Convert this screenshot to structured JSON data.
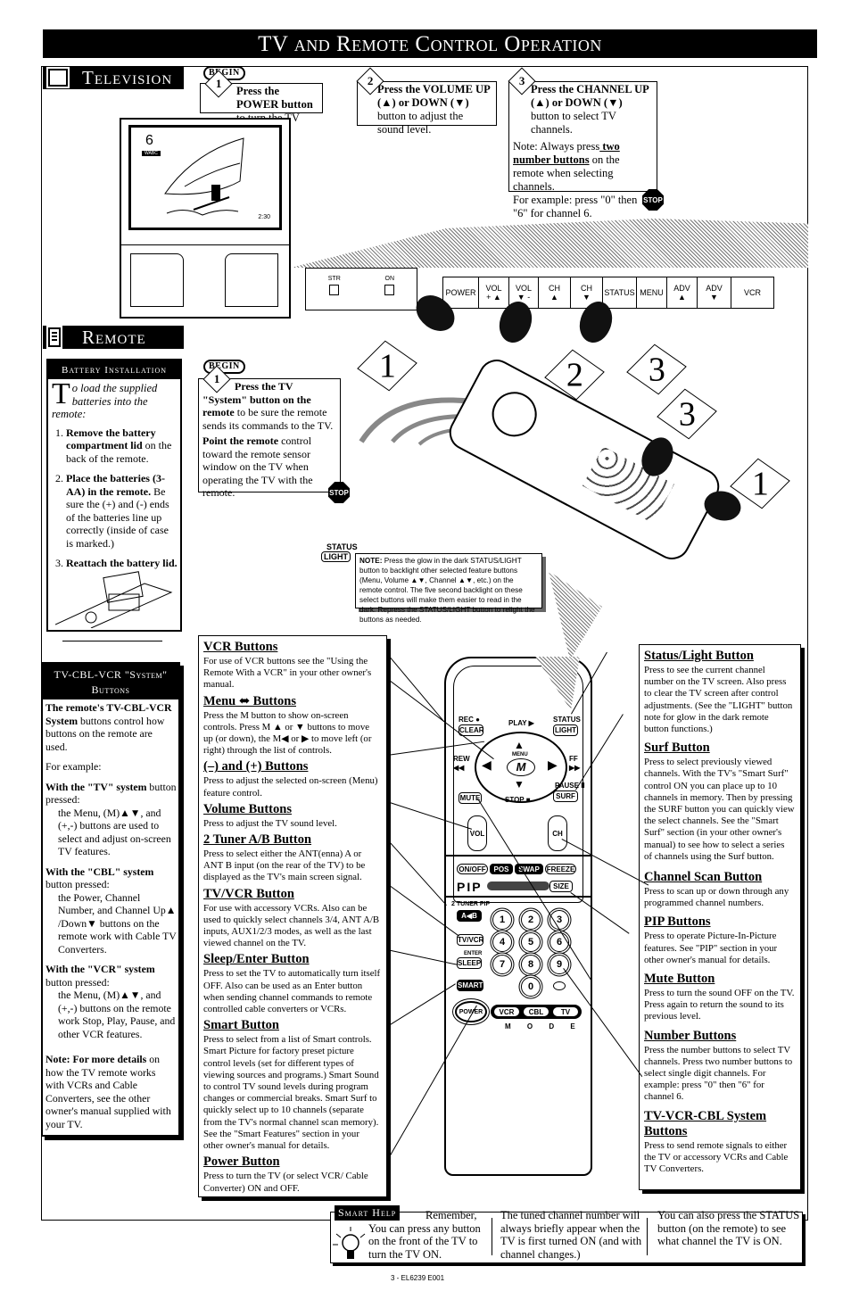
{
  "page_title": "TV and Remote Control Operation",
  "television": {
    "section_label": "Television",
    "begin_label": "BEGIN",
    "stop_label": "STOP",
    "steps": [
      {
        "number": "1",
        "bold": "Press the POWER button",
        "text": " to turn the TV ON."
      },
      {
        "number": "2",
        "bold": "Press the VOLUME UP (▲) or DOWN (▼)",
        "text": " button to adjust the sound level."
      },
      {
        "number": "3",
        "bold": "Press the CHANNEL UP (▲) or DOWN (▼)",
        "text": " button to select TV channels."
      }
    ],
    "step3_note": {
      "prefix": "Note: Always press",
      "underline": " two number buttons",
      "suffix": " on the remote when selecting channels.",
      "example": "For example: press \"0\" then \"6\" for channel 6."
    },
    "screen": {
      "channel": "6",
      "channel_tag": "WABC",
      "time": "2:30"
    },
    "front_panel": {
      "left_buttons": [
        "STR",
        "ON"
      ],
      "buttons": [
        {
          "top": "POWER",
          "bottom": ""
        },
        {
          "top": "VOL",
          "bottom": "+ ▲"
        },
        {
          "top": "VOL",
          "bottom": "▼ -"
        },
        {
          "top": "CH",
          "bottom": "▲"
        },
        {
          "top": "CH",
          "bottom": "▼"
        },
        {
          "top": "STATUS",
          "bottom": ""
        },
        {
          "top": "MENU",
          "bottom": ""
        },
        {
          "top": "ADV",
          "bottom": "▲"
        },
        {
          "top": "ADV",
          "bottom": "▼"
        },
        {
          "top": "VCR",
          "bottom": ""
        }
      ]
    },
    "hand_labels": [
      "1",
      "2",
      "3"
    ]
  },
  "remote": {
    "section_label": "Remote",
    "begin_label": "BEGIN",
    "stop_label": "STOP",
    "step1": {
      "number": "1",
      "bold": "Press the TV \"System\" button on the remote",
      "text": " to be sure the remote sends its commands to the TV.",
      "bold2": "Point the remote",
      "text2": " control toward the remote sensor window on the TV when operating the TV with the remote."
    },
    "hand_labels": [
      "3",
      "1"
    ],
    "battery": {
      "heading": "Battery Installation",
      "dropcap": "T",
      "intro": "o load the supplied batteries into the remote:",
      "steps": [
        {
          "bold": "Remove the battery compartment lid",
          "text": " on the back of the remote."
        },
        {
          "bold": "Place the batteries (3-AA) in the remote.",
          "text": " Be sure the (+) and (-) ends of the batteries line up correctly (inside of case is marked.)"
        },
        {
          "bold": "Reattach the battery lid.",
          "text": ""
        }
      ]
    },
    "light_note": {
      "status_label": "STATUS",
      "light_label": "LIGHT",
      "bold": "NOTE:",
      "text": " Press the glow in the dark STATUS/LIGHT button to backlight other selected feature buttons (Menu, Volume ▲▼, Channel ▲▼, etc.) on the remote control. The five second backlight on these select buttons will make them easier to read in the dark. Repress the STATUS/LIGHT button to relight the buttons as needed."
    }
  },
  "system_buttons": {
    "heading_line1": "TV-CBL-VCR \"System\"",
    "heading_line2": "Buttons",
    "intro_bold": "The remote's TV-CBL-VCR System",
    "intro_text": " buttons control how buttons on the remote are used.",
    "example": "For example:",
    "tv_bold": "With the \"TV\" system",
    "tv_text": " button pressed:",
    "tv_detail": "the Menu, (M)▲▼, and (+,-) buttons are used to select and adjust on-screen TV features.",
    "cbl_bold": "With the \"CBL\" system",
    "cbl_text": " button pressed:",
    "cbl_detail": "the Power, Channel Number, and Channel Up▲ /Down▼ buttons on the remote work with Cable TV Converters.",
    "vcr_bold": "With the \"VCR\" system",
    "vcr_text": " button pressed:",
    "vcr_detail": "the Menu, (M)▲▼, and (+,-) buttons on the remote work Stop, Play, Pause, and other VCR features.",
    "note_bold": "Note: For more details",
    "note_text": " on how the TV remote works with VCRs and Cable Converters, see the other owner's manual supplied with your TV."
  },
  "left_descriptions": [
    {
      "title": "VCR Buttons",
      "text": "For use of VCR buttons see the \"Using the Remote With a VCR\" in your other owner's manual."
    },
    {
      "title": "Menu ⬌ Buttons",
      "text": "Press the M button to show on-screen controls. Press M ▲ or ▼ buttons to move up (or down), the M◀ or ▶ to move left (or right) through the list of controls."
    },
    {
      "title": "(–) and (+) Buttons",
      "text": "Press to adjust the selected on-screen (Menu) feature control."
    },
    {
      "title": "Volume Buttons",
      "text": "Press to adjust the TV sound level."
    },
    {
      "title": "2 Tuner A/B Button",
      "text": "Press to select either the ANT(enna) A or ANT B input (on the rear of the TV) to be displayed as the TV's main screen signal."
    },
    {
      "title": "TV/VCR Button",
      "text": "For use with accessory VCRs. Also can be used to quickly select channels 3/4, ANT A/B inputs, AUX1/2/3 modes, as well as the last viewed channel on the TV."
    },
    {
      "title": "Sleep/Enter Button",
      "text": "Press to set the TV to automatically turn itself OFF. Also can be used as an Enter button when sending channel commands to remote controlled cable converters or VCRs."
    },
    {
      "title": "Smart Button",
      "text": "Press to select from a list of Smart controls. Smart Picture for factory preset picture control levels (set for different types of viewing sources and programs.) Smart Sound to control TV sound levels during program changes or commercial breaks. Smart Surf to quickly select up to 10 channels (separate from the TV's normal channel scan memory). See the \"Smart Features\" section in your other owner's manual for details."
    },
    {
      "title": "Power Button",
      "text": "Press to turn the TV (or select VCR/ Cable Converter) ON and OFF."
    }
  ],
  "right_descriptions": [
    {
      "title": "Status/Light Button",
      "text": "Press to see the current channel number on the TV screen. Also press to clear the TV screen after control adjustments. (See the \"LIGHT\" button note for glow in the dark remote button functions.)"
    },
    {
      "title": "Surf Button",
      "text": "Press to select previously viewed channels. With the TV's \"Smart Surf\" control ON you can place up to 10 channels in memory. Then by pressing the SURF button you can quickly view the select channels. See the \"Smart Surf\" section (in your other owner's manual) to see how to select a series of channels using the Surf button."
    },
    {
      "title": "Channel Scan Button",
      "text": "Press to scan up or down through any programmed channel numbers."
    },
    {
      "title": "PIP Buttons",
      "text": "Press to operate Picture-In-Picture features. See \"PIP\" section in your other owner's manual for details."
    },
    {
      "title": "Mute Button",
      "text": "Press to turn the sound OFF on the TV. Press again to return the sound to its previous level."
    },
    {
      "title": "Number Buttons",
      "text": "Press the number buttons to select TV channels. Press two number buttons to select single digit channels. For example: press \"0\" then \"6\" for channel 6."
    },
    {
      "title": "TV-VCR-CBL System Buttons",
      "text": "Press to send remote signals to either the TV or accessory VCRs and Cable TV Converters."
    }
  ],
  "remote_diagram": {
    "rec": "REC ●",
    "clear": "CLEAR",
    "play": "PLAY ▶",
    "status": "STATUS",
    "light": "LIGHT",
    "rew": "REW ◀◀",
    "ff": "FF ▶▶",
    "menu": "MENU",
    "m": "M",
    "pause": "PAUSE II",
    "surf": "SURF",
    "mute": "MUTE",
    "stop": "STOP ■",
    "vol": "VOL",
    "ch": "CH",
    "pip_row": [
      "ON/OFF",
      "POS",
      "SWAP",
      "FREEZE"
    ],
    "pip_label": "PIP",
    "size": "SIZE",
    "tuner_pip": "2 TUNER PIP",
    "tuner_btn": "A◀B",
    "tvvcr": "TV/VCR",
    "enter": "ENTER",
    "sleep": "SLEEP",
    "smart": "SMART",
    "power": "POWER",
    "numbers": [
      "1",
      "2",
      "3",
      "4",
      "5",
      "6",
      "7",
      "8",
      "9",
      "0"
    ],
    "modes": [
      "VCR",
      "CBL",
      "TV"
    ],
    "mode_label": "M O D E"
  },
  "smart_help": {
    "label": "Smart Help",
    "col1": "Remember, You can press any button on the front of the TV to turn the TV ON.",
    "col2": "The tuned channel number will always briefly appear when the TV is first turned ON (and with channel changes.)",
    "col3": "You can also press the STATUS button (on the remote) to see what channel the TV is ON."
  },
  "footer": "3 - EL6239 E001"
}
